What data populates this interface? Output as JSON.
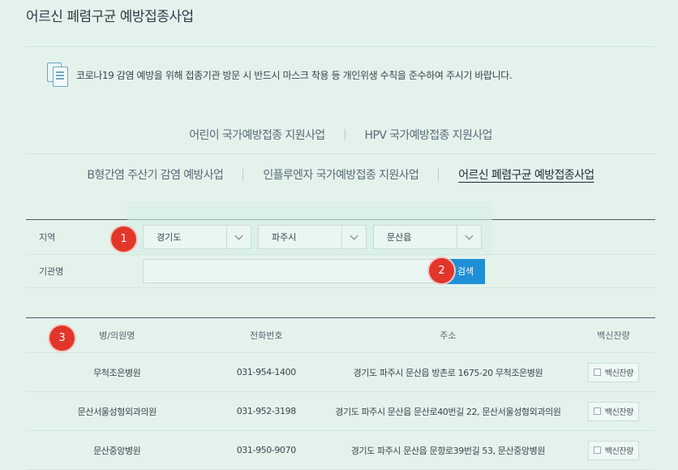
{
  "page": {
    "title": "어르신 폐렴구균 예방접종사업"
  },
  "notice": {
    "text": "코로나19 감염 예방을 위해 접종기관 방문 시 반드시 마스크 착용 등 개인위생 수칙을 준수하여 주시기 바랍니다."
  },
  "tabs": {
    "row1": [
      "어린이 국가예방접종 지원사업",
      "HPV 국가예방접종 지원사업"
    ],
    "row2": [
      "B형간염 주산기 감염 예방사업",
      "인플루엔자 국가예방접종 지원사업",
      "어르신 폐렴구균 예방접종사업"
    ],
    "active": "어르신 폐렴구균 예방접종사업"
  },
  "search": {
    "region_label": "지역",
    "province": "경기도",
    "city": "파주시",
    "district": "문산읍",
    "institution_label": "기관명",
    "institution_value": "",
    "button": "검색"
  },
  "markers": [
    "1",
    "2",
    "3"
  ],
  "table": {
    "headers": [
      "병/의원명",
      "전화번호",
      "주소",
      "백신잔량"
    ],
    "rows": [
      {
        "name": "무척조은병원",
        "phone": "031-954-1400",
        "address": "경기도 파주시 문산읍 방촌로 1675-20 무척조은병원",
        "button": "백신잔량"
      },
      {
        "name": "문산서울성형외과의원",
        "phone": "031-952-3198",
        "address": "경기도 파주시 문산읍 문산로40번길 22, 문산서울성형외과의원",
        "button": "백신잔량"
      },
      {
        "name": "문산중앙병원",
        "phone": "031-950-9070",
        "address": "경기도 파주시 문산읍 문향로39번길 53, 문산중앙병원",
        "button": "백신잔량"
      }
    ]
  },
  "colors": {
    "background": "#e3f3ec",
    "accent": "#1f8fd8",
    "marker": "#e2362b"
  }
}
